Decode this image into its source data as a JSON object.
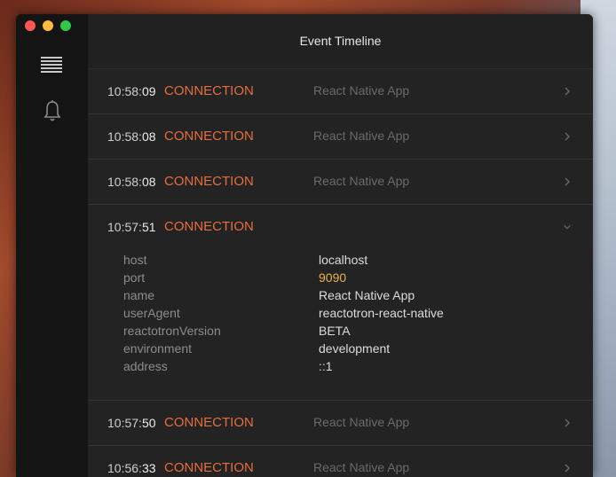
{
  "header": {
    "title": "Event Timeline"
  },
  "colors": {
    "accent": "#e46d3e",
    "number": "#e7b54a"
  },
  "events": [
    {
      "time_hm": "10:58:",
      "time_s": "09",
      "type": "CONNECTION",
      "desc": "React Native App"
    },
    {
      "time_hm": "10:58:",
      "time_s": "08",
      "type": "CONNECTION",
      "desc": "React Native App"
    },
    {
      "time_hm": "10:58:",
      "time_s": "08",
      "type": "CONNECTION",
      "desc": "React Native App"
    },
    {
      "time_hm": "10:57:",
      "time_s": "51",
      "type": "CONNECTION",
      "desc": ""
    },
    {
      "time_hm": "10:57:",
      "time_s": "50",
      "type": "CONNECTION",
      "desc": "React Native App"
    },
    {
      "time_hm": "10:56:",
      "time_s": "33",
      "type": "CONNECTION",
      "desc": "React Native App"
    }
  ],
  "details": {
    "host": "localhost",
    "port": "9090",
    "name": "React Native App",
    "userAgent": "reactotron-react-native",
    "reactotronVersion": "BETA",
    "environment": "development",
    "address": "::1"
  },
  "detail_keys": {
    "host": "host",
    "port": "port",
    "name": "name",
    "userAgent": "userAgent",
    "reactotronVersion": "reactotronVersion",
    "environment": "environment",
    "address": "address"
  }
}
